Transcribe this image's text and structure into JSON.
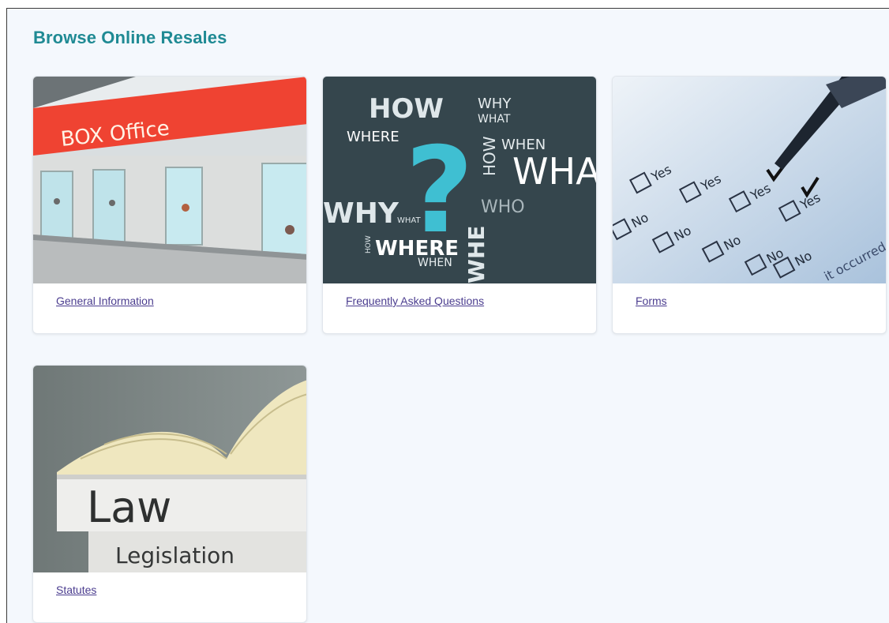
{
  "page": {
    "title": "Browse Online Resales"
  },
  "cards": [
    {
      "id": "general-information",
      "link_label": "General Information",
      "image": {
        "icon": "box-office-photo",
        "sign_text": "BOX  Office"
      }
    },
    {
      "id": "faq",
      "link_label": "Frequently Asked Questions",
      "image": {
        "icon": "question-words-photo",
        "words": [
          "HOW",
          "WHY",
          "WHAT",
          "WHERE",
          "WHEN",
          "HOW",
          "WHA",
          "WHY",
          "WHAT",
          "WHO",
          "HOW",
          "WHERE",
          "WHEN",
          "WHE",
          "?"
        ]
      }
    },
    {
      "id": "forms",
      "link_label": "Forms",
      "image": {
        "icon": "checkbox-form-photo",
        "words": [
          "Yes",
          "No",
          "Yes",
          "No",
          "Yes",
          "No",
          "Yes",
          "No",
          "No",
          "it occurred, and"
        ]
      }
    },
    {
      "id": "statutes",
      "link_label": "Statutes",
      "image": {
        "icon": "law-books-photo",
        "book_top": "Law",
        "book_bottom": "Legislation"
      }
    }
  ],
  "colors": {
    "title": "#1f8a94",
    "link": "#4b3d8f",
    "background": "#f4f8fd"
  }
}
